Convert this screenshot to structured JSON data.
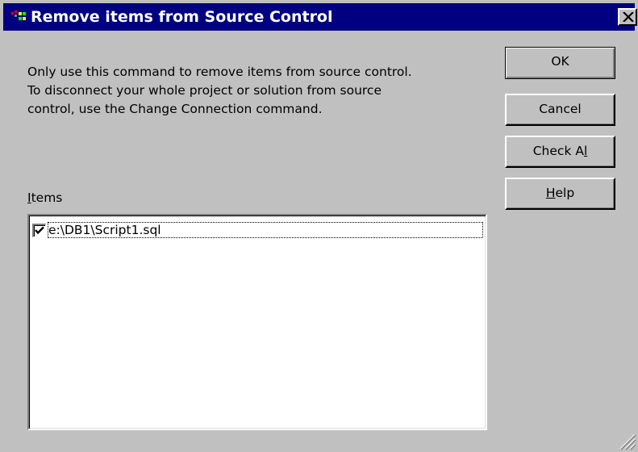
{
  "window": {
    "title": "Remove items from Source Control",
    "icon": "vss-app-icon",
    "close_icon": "close-icon"
  },
  "message": {
    "lines": [
      "Only use this command to remove items from source control.",
      "To disconnect your whole project or solution from source",
      "control, use the Change Connection command."
    ]
  },
  "buttons": {
    "ok": "OK",
    "cancel": "Cancel",
    "check_all_prefix": "Check A",
    "check_all_mnemonic": "l",
    "check_all_suffix": "l",
    "help_mnemonic": "H",
    "help_suffix": "elp"
  },
  "items": {
    "label_mnemonic": "I",
    "label_suffix": "tems",
    "list": [
      {
        "path": "e:\\DB1\\Script1.sql",
        "checked": true
      }
    ]
  },
  "colors": {
    "titlebar": "#000080",
    "face": "#c0c0c0"
  }
}
